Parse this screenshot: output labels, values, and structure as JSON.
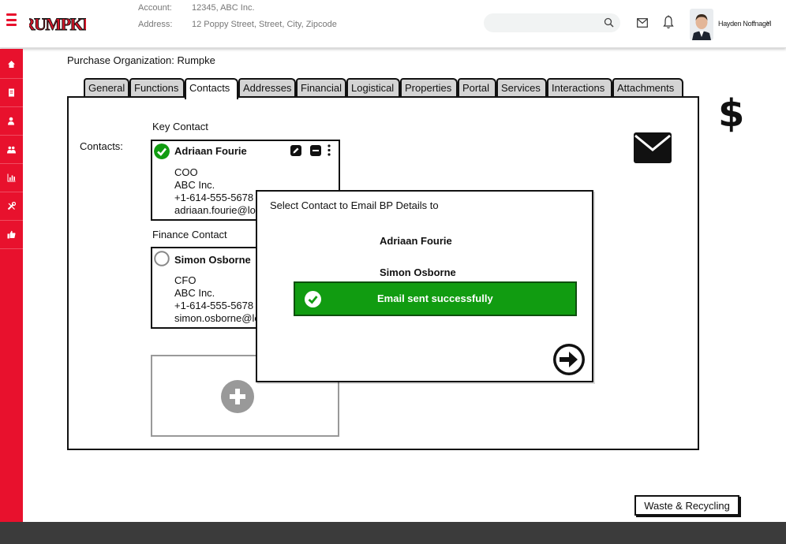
{
  "header": {
    "brand": "RUMPKE",
    "account_label": "Account:",
    "account_value": "12345, ABC Inc.",
    "address_label": "Address:",
    "address_value": "12 Poppy Street, Street, City, Zipcode",
    "search_placeholder": "",
    "user_name": "Hayden Noffnagel",
    "caret": "˅"
  },
  "sidebar": {
    "items": [
      "home-icon",
      "document-icon",
      "user-icon",
      "group-icon",
      "chart-icon",
      "tools-icon",
      "thumbs-up-icon"
    ]
  },
  "main": {
    "purchase_org_label": "Purchase Organization:",
    "purchase_org_value": "Rumpke",
    "tabs": [
      {
        "label": "General"
      },
      {
        "label": "Functions"
      },
      {
        "label": "Contacts",
        "active": true
      },
      {
        "label": "Addresses"
      },
      {
        "label": "Financial"
      },
      {
        "label": "Logistical"
      },
      {
        "label": "Properties"
      },
      {
        "label": "Portal"
      },
      {
        "label": "Services"
      },
      {
        "label": "Interactions"
      },
      {
        "label": "Attachments"
      }
    ],
    "contacts_label": "Contacts:",
    "key_contact": {
      "heading": "Key Contact",
      "name": "Adriaan Fourie",
      "title": "COO",
      "company": "ABC Inc.",
      "phone": "+1-614-555-5678",
      "email": "adriaan.fourie@lo",
      "selected": true
    },
    "finance_contact": {
      "heading": "Finance Contact",
      "name": "Simon Osborne",
      "title": "CFO",
      "company": "ABC Inc.",
      "phone": "+1-614-555-5678",
      "email": "simon.osborne@lo",
      "selected": false
    },
    "dollar_symbol": "$"
  },
  "modal": {
    "title": "Select Contact to Email BP Details to",
    "options": [
      "Adriaan Fourie",
      "Simon Osborne"
    ],
    "toast": "Email sent successfully"
  },
  "footer_button": "Waste & Recycling",
  "colors": {
    "brand_red": "#e8112d",
    "success_green": "#119c11",
    "footer_dark": "#3b3b3b"
  }
}
